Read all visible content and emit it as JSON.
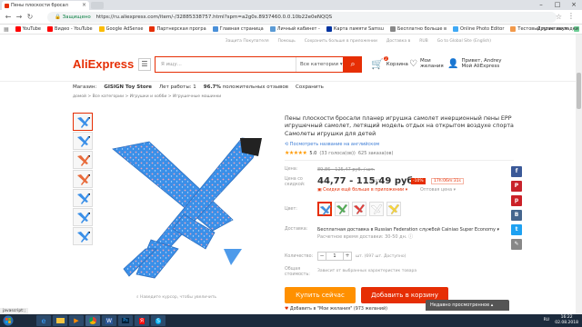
{
  "browser": {
    "tab_title": "Пены плоскости бросал",
    "secure_label": "Защищено",
    "url": "https://ru.aliexpress.com/item/-/32885338757.html?spm=a2g0s.8937460.0.0.10b22e0eNQQS",
    "bookmarks": [
      {
        "label": "YouTube",
        "color": "#ff0000"
      },
      {
        "label": "Видео - YouTube",
        "color": "#ff0000"
      },
      {
        "label": "Google AdSense",
        "color": "#fbbc04"
      },
      {
        "label": "Партнерская програ",
        "color": "#e62e04"
      },
      {
        "label": "Главная страница",
        "color": "#4a90d9"
      },
      {
        "label": "Личный кабинет -",
        "color": "#5b9bd5"
      },
      {
        "label": "Карта памяти Samsu",
        "color": "#0033a0"
      },
      {
        "label": "Бесплатно больше в",
        "color": "#888888"
      },
      {
        "label": "Online Photo Editor",
        "color": "#3fa9f5"
      },
      {
        "label": "Тестовый практикум",
        "color": "#f2994a"
      },
      {
        "label": "Комплексный анали",
        "color": "#6fcf97"
      }
    ],
    "bookmarks_right": "Другие закладки"
  },
  "topnav": [
    "Защита Покупателя",
    "Помощь",
    "Сохранить больше в приложении",
    "Доставка в",
    "RUB",
    "Go to Global Site (English)"
  ],
  "header": {
    "logo": "AliExpress",
    "search_placeholder": "Я ищу...",
    "search_category": "Все категории",
    "cart_count": "2",
    "cart_label": "Корзина",
    "wish_line1": "Мои",
    "wish_line2": "желания",
    "user_line1": "Привет, Andrey",
    "user_line2": "Мой AliExpress"
  },
  "store": {
    "prefix": "Магазин:",
    "name": "GISIGN Toy Store",
    "years_label": "Лет работы: 1",
    "percent": "96.7%",
    "feedback_label": "положительных отзывов",
    "save_label": "Сохранить"
  },
  "breadcrumb": "домой  >  Все категории  >  Игрушки и хобби  >  Игрушечные машинки",
  "gallery": {
    "zoom_hint": "Наведите курсор, чтобы увеличить"
  },
  "product": {
    "title": "Пены плоскости бросали планер игрушка самолет инерционный пены EPP игрушечный самолет, летящий модель отдых на открытом воздухе спорта Самолеты игрушки для детей",
    "translate_link": "Посмотреть название на английском",
    "rating_value": "5.0",
    "rating_count": "(33 голоса(ов))",
    "orders": "625 заказа(ов)",
    "price_label": "Цена:",
    "old_price": "89,86 - 125,47 руб. / шт.",
    "discount_price_label": "Цена со скидкой:",
    "price": "44,77 - 115,49 руб.",
    "unit": "/ шт.",
    "discount": "-10%",
    "timer": "17h:06m:31s",
    "app_deal": "Скидки ещё больше в приложении",
    "wholesale": "Оптовая цена",
    "color_label": "Цвет:",
    "shipping_label": "Доставка:",
    "shipping_text": "Бесплатная доставка в Russian Federation службой Cainiao Super Economy",
    "delivery_time": "Расчетное время доставки: 30-50 дн.",
    "qty_label": "Количество:",
    "qty_value": "1",
    "qty_note": "шт. (697 шт. Доступно)",
    "total_label": "Общая стоимость:",
    "total_note": "Зависит от выбранных характеристик товара",
    "buy_now": "Купить сейчас",
    "add_to_cart": "Добавить в корзину",
    "wishlist": "Добавить в \"Мои желания\" (973 желаний)"
  },
  "recent_viewed": "Недавно просмотренное",
  "status_url": "javascript:;",
  "taskbar": {
    "lang": "RU",
    "time": "16:22",
    "date": "02.08.2018"
  },
  "colors": {
    "brand": "#e62e04",
    "buy": "#ff9000",
    "plane": "#3a8fe8"
  }
}
